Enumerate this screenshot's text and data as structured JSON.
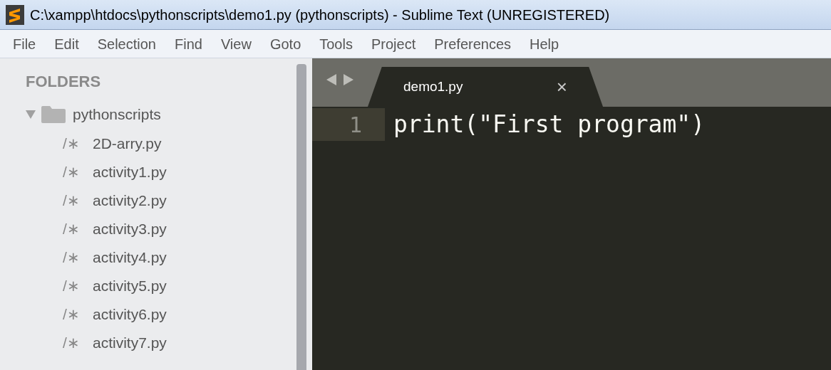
{
  "window": {
    "title": "C:\\xampp\\htdocs\\pythonscripts\\demo1.py (pythonscripts) - Sublime Text (UNREGISTERED)"
  },
  "menu": [
    "File",
    "Edit",
    "Selection",
    "Find",
    "View",
    "Goto",
    "Tools",
    "Project",
    "Preferences",
    "Help"
  ],
  "sidebar": {
    "heading": "FOLDERS",
    "folder": {
      "name": "pythonscripts",
      "expanded": true,
      "children": [
        {
          "icon": "/∗",
          "name": "2D-arry.py"
        },
        {
          "icon": "/∗",
          "name": "activity1.py"
        },
        {
          "icon": "/∗",
          "name": "activity2.py"
        },
        {
          "icon": "/∗",
          "name": "activity3.py"
        },
        {
          "icon": "/∗",
          "name": "activity4.py"
        },
        {
          "icon": "/∗",
          "name": "activity5.py"
        },
        {
          "icon": "/∗",
          "name": "activity6.py"
        },
        {
          "icon": "/∗",
          "name": "activity7.py"
        }
      ]
    }
  },
  "tabs": [
    {
      "label": "demo1.py",
      "selected": true,
      "close": "×"
    }
  ],
  "editor": {
    "lines": [
      {
        "number": "1",
        "text": "print(\"First program\")",
        "current": true
      }
    ]
  }
}
